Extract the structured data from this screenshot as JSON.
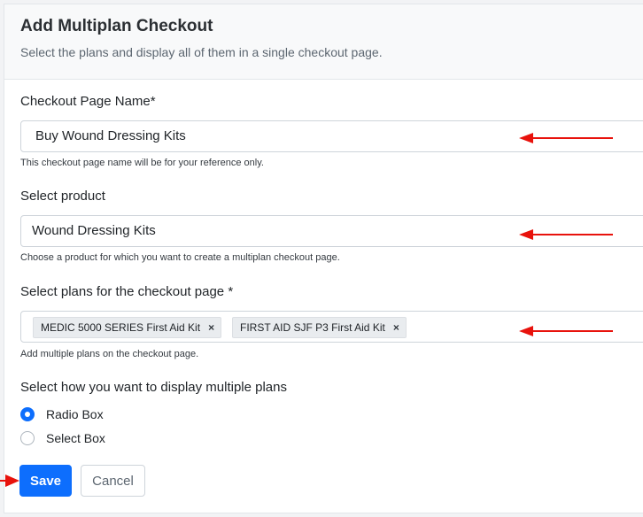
{
  "header": {
    "title": "Add Multiplan Checkout",
    "subtitle": "Select the plans and display all of them in a single checkout page."
  },
  "checkout_name": {
    "label": "Checkout Page Name*",
    "value": "Buy Wound Dressing Kits",
    "help": "This checkout page name will be for your reference only."
  },
  "product": {
    "label": "Select product",
    "value": "Wound Dressing Kits",
    "help": "Choose a product for which you want to create a multiplan checkout page."
  },
  "plans": {
    "label": "Select plans for the checkout page *",
    "selected": [
      {
        "label": "MEDIC 5000 SERIES First Aid Kit",
        "remove": "×"
      },
      {
        "label": "FIRST AID SJF P3 First Aid Kit",
        "remove": "×"
      }
    ],
    "help": "Add multiple plans on the checkout page."
  },
  "display": {
    "label": "Select how you want to display multiple plans",
    "options": [
      {
        "label": "Radio Box",
        "checked": true
      },
      {
        "label": "Select Box",
        "checked": false
      }
    ]
  },
  "actions": {
    "save_label": "Save",
    "cancel_label": "Cancel"
  },
  "colors": {
    "primary": "#0d6efd",
    "annotation_arrow": "#e8120c"
  },
  "icons": {
    "annotation": "red-arrow-icon",
    "tag_remove": "close-icon"
  }
}
